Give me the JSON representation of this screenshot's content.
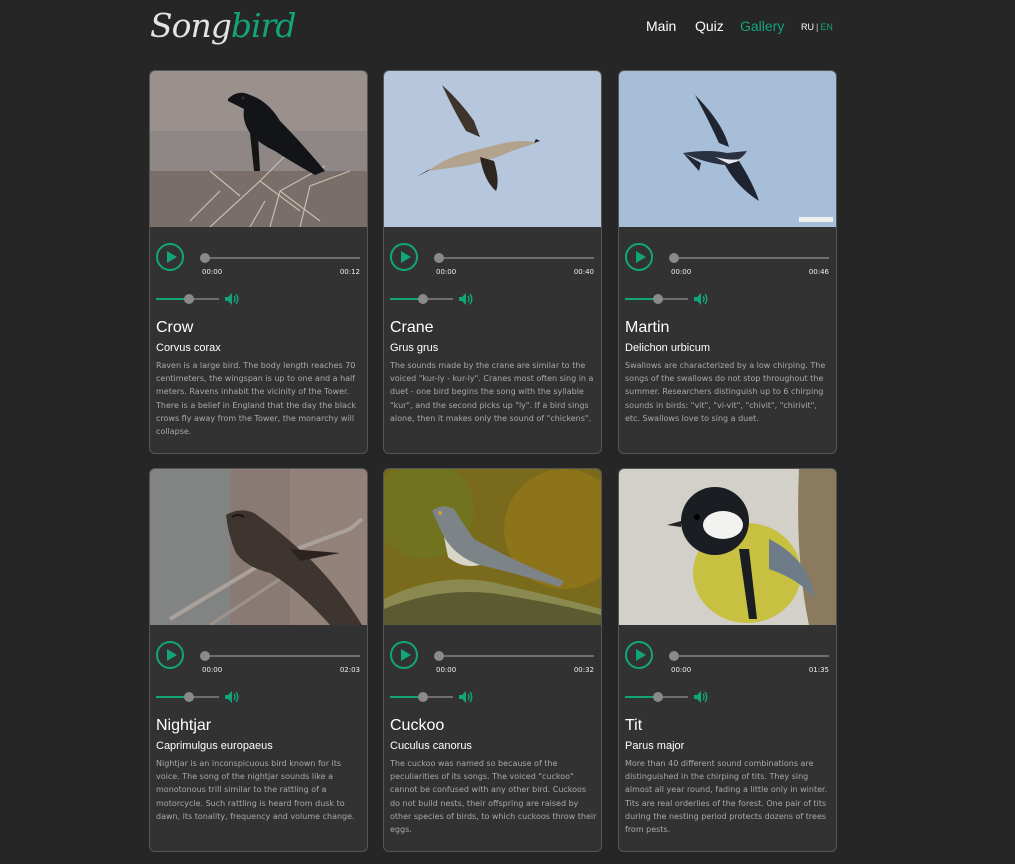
{
  "header": {
    "logo_part1": "Song",
    "logo_part2": "bird",
    "nav": [
      "Main",
      "Quiz",
      "Gallery"
    ],
    "active_nav": "Gallery",
    "lang_ru": "RU",
    "lang_sep": "|",
    "lang_en": "EN"
  },
  "colors": {
    "accent": "#12a57a",
    "background": "#262626",
    "card": "#323232"
  },
  "birds": [
    {
      "name": "Crow",
      "latin": "Corvus corax",
      "current_time": "00:00",
      "duration": "00:12",
      "description": "Raven is a large bird. The body length reaches 70 centimeters, the wingspan is up to one and a half meters. Ravens inhabit the vicinity of the Tower. There is a belief in England that the day the black crows fly away from the Tower, the monarchy will collapse."
    },
    {
      "name": "Crane",
      "latin": "Grus grus",
      "current_time": "00:00",
      "duration": "00:40",
      "description": "The sounds made by the crane are similar to the voiced \"kur-ly - kur-ly\". Cranes most often sing in a duet - one bird begins the song with the syllable \"kur\", and the second picks up \"ly\". If a bird sings alone, then it makes only the sound of \"chickens\"."
    },
    {
      "name": "Martin",
      "latin": "Delichon urbicum",
      "current_time": "00:00",
      "duration": "00:46",
      "description": "Swallows are characterized by a low chirping. The songs of the swallows do not stop throughout the summer. Researchers distinguish up to 6 chirping sounds in birds: \"vit\", \"vi-vit\", \"chivit\", \"chirivit\", etc. Swallows love to sing a duet."
    },
    {
      "name": "Nightjar",
      "latin": "Caprimulgus europaeus",
      "current_time": "00:00",
      "duration": "02:03",
      "description": "Nightjar is an inconspicuous bird known for its voice. The song of the nightjar sounds like a monotonous trill similar to the rattling of a motorcycle. Such rattling is heard from dusk to dawn, its tonality, frequency and volume change."
    },
    {
      "name": "Cuckoo",
      "latin": "Cuculus canorus",
      "current_time": "00:00",
      "duration": "00:32",
      "description": "The cuckoo was named so because of the peculiarities of its songs. The voiced \"cuckoo\" cannot be confused with any other bird. Cuckoos do not build nests, their offspring are raised by other species of birds, to which cuckoos throw their eggs."
    },
    {
      "name": "Tit",
      "latin": "Parus major",
      "current_time": "00:00",
      "duration": "01:35",
      "description": "More than 40 different sound combinations are distinguished in the chirping of tits. They sing almost all year round, fading a little only in winter. Tits are real orderlies of the forest. One pair of tits during the nesting period protects dozens of trees from pests."
    }
  ]
}
